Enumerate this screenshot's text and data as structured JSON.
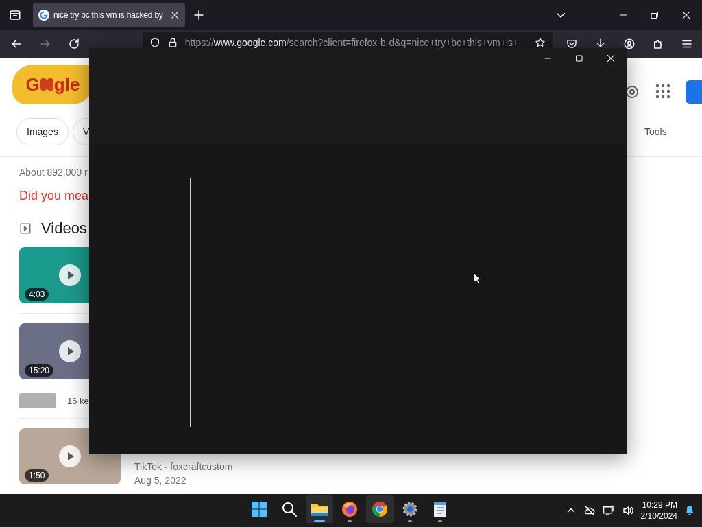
{
  "browser": {
    "tab": {
      "title": "nice try bc this vm is hacked by",
      "selected": true
    },
    "url": {
      "host": "https://www.google.com",
      "path": "/search?client=firefox-b-d&q=nice+try+bc+this+vm+is+"
    },
    "forward_disabled": true
  },
  "page": {
    "doodle": {
      "left": "G",
      "right": "gle"
    },
    "chips": [
      {
        "label": "Images"
      },
      {
        "label": "V"
      }
    ],
    "tools": "Tools",
    "result_stats": "About 892,000 r",
    "did_you_mean": "Did you mea",
    "videos_heading": "Videos",
    "videos": [
      {
        "kind": "thumb",
        "duration": "4:03",
        "color": "#1a9a8c"
      },
      {
        "kind": "thumb",
        "duration": "15:20",
        "color": "#6b6f86"
      },
      {
        "kind": "compact",
        "text": "16 ke"
      },
      {
        "kind": "thumb",
        "duration": "1:50",
        "color": "#b9a89a",
        "source": "TikTok · foxcraftcustom",
        "date": "Aug 5, 2022"
      }
    ]
  },
  "taskbar": {
    "apps": [
      {
        "kind": "start",
        "running": false,
        "selected": false
      },
      {
        "kind": "search",
        "running": false,
        "selected": false
      },
      {
        "kind": "explorer",
        "running": true,
        "selected": true
      },
      {
        "kind": "firefox",
        "running": true,
        "selected": false
      },
      {
        "kind": "chrome",
        "running": false,
        "selected": true
      },
      {
        "kind": "settings",
        "running": true,
        "selected": false
      },
      {
        "kind": "notepad",
        "running": true,
        "selected": false
      }
    ],
    "time": "10:29 PM",
    "date": "2/10/2024"
  }
}
